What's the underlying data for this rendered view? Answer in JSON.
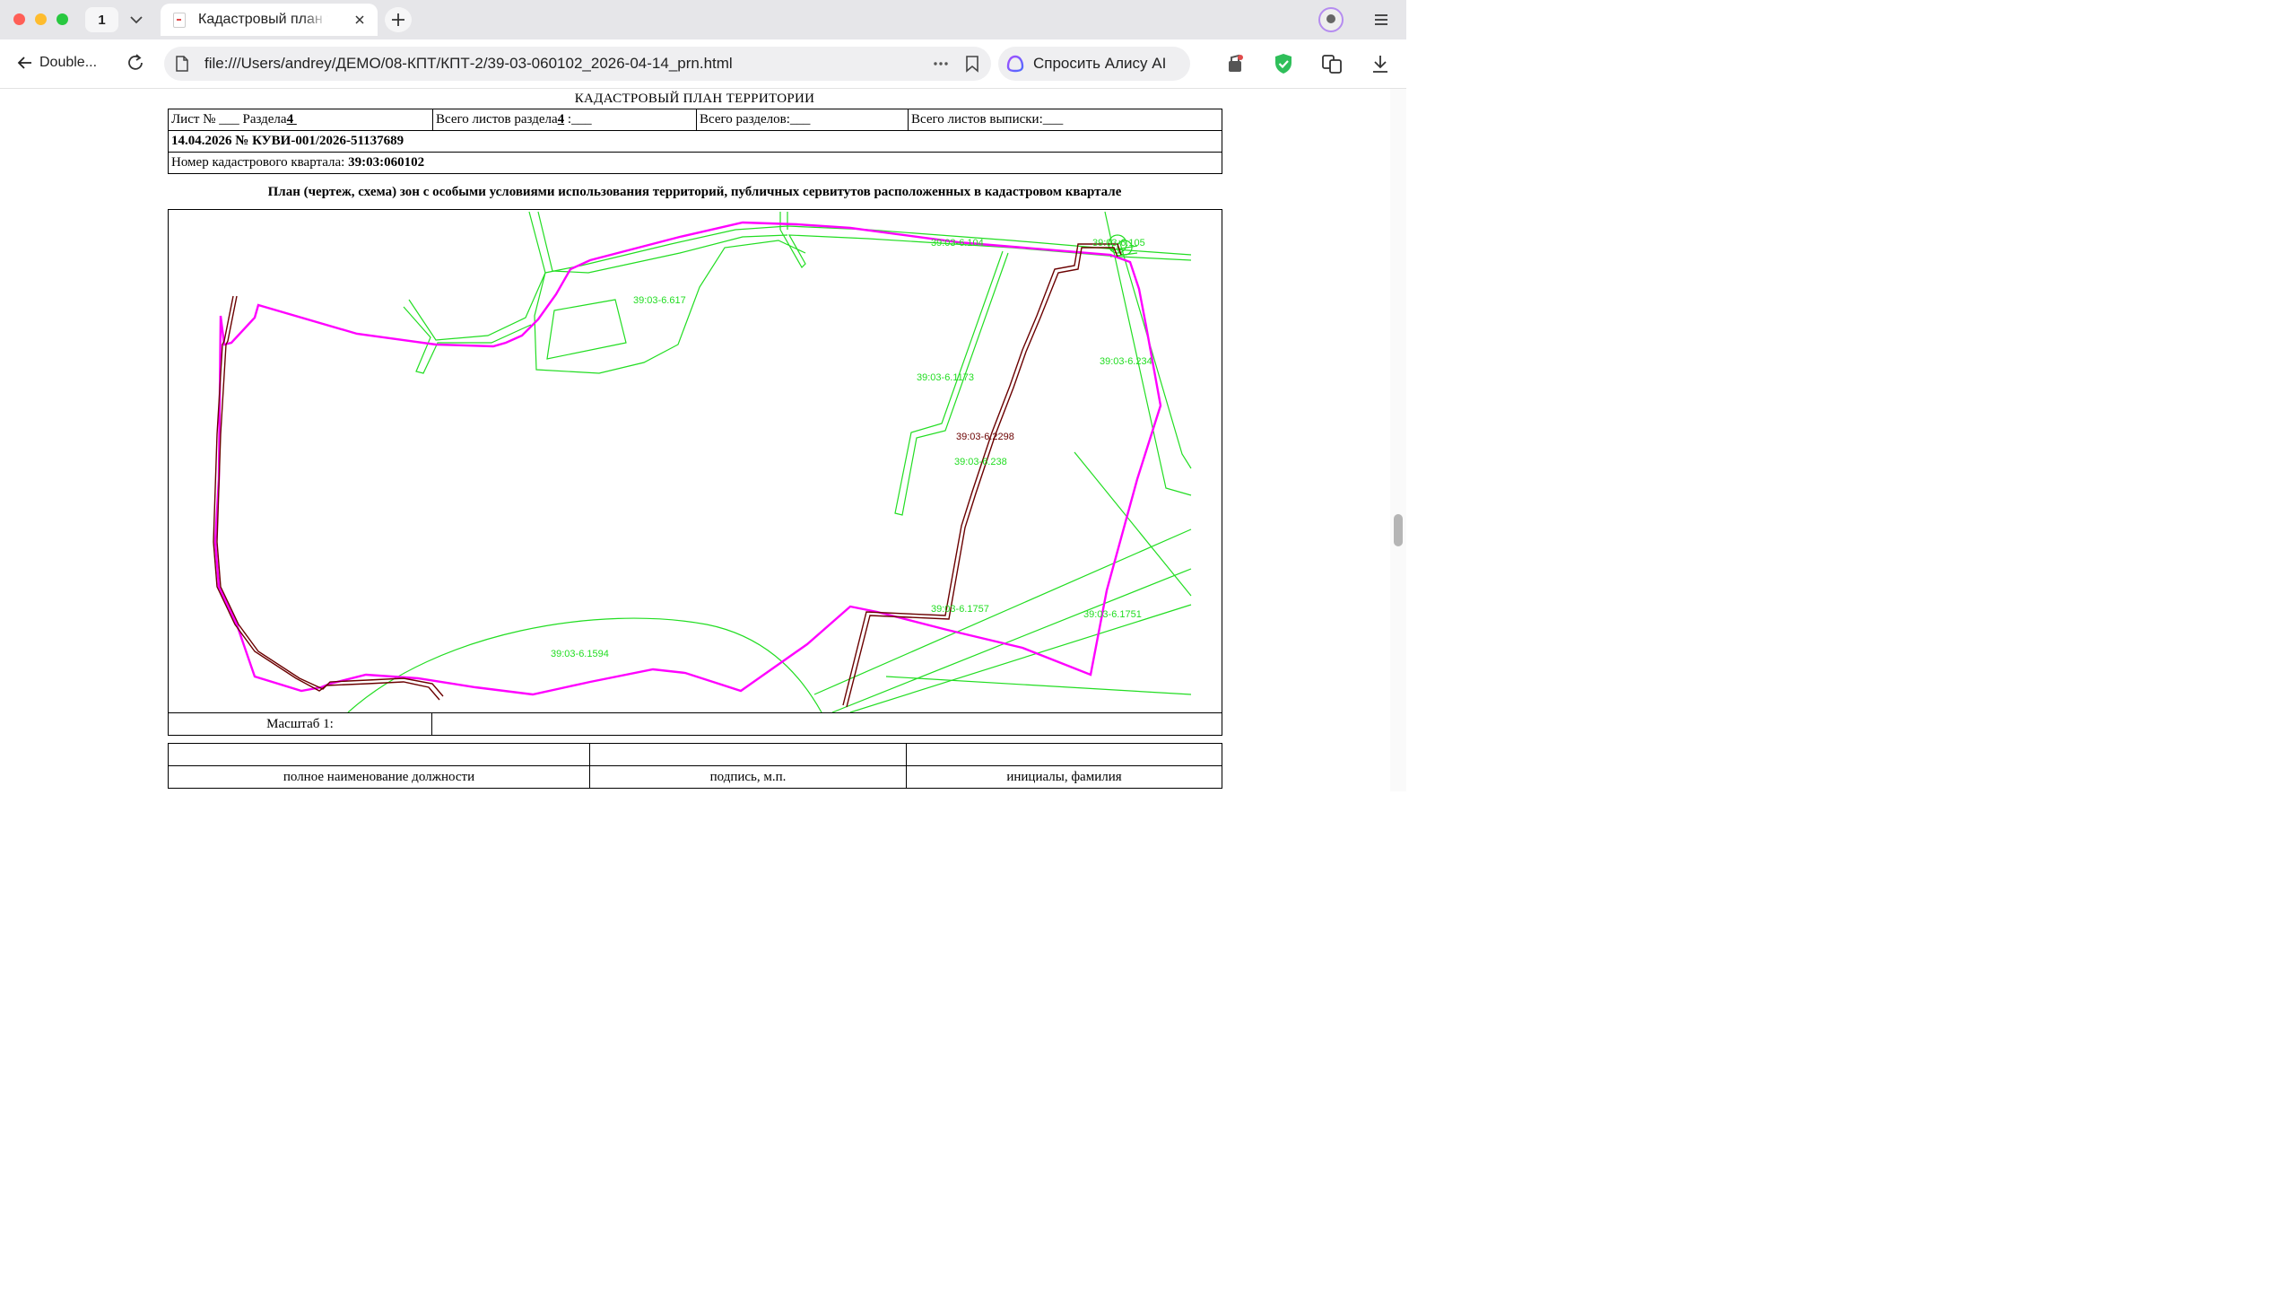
{
  "browser": {
    "tab_count": "1",
    "tab_title": "Кадастровый план территории",
    "back_label": "Double...",
    "url": "file:///Users/andrey/ДЕМО/08-КПТ/КПТ-2/39-03-060102_2026-04-14_prn.html",
    "alice_label": "Спросить Алису AI",
    "icons": [
      "chevron-down-icon",
      "close-icon",
      "plus-icon",
      "avatar",
      "menu-icon",
      "back-arrow-icon",
      "reload-icon",
      "file-icon",
      "more-icon",
      "bookmark-icon",
      "alice-icon",
      "extension-icon",
      "shield-icon",
      "translate-icon",
      "download-icon"
    ]
  },
  "document": {
    "title": "КАДАСТРОВЫЙ ПЛАН ТЕРРИТОРИИ",
    "sheet": {
      "prefix": "Лист № ",
      "blank": "___",
      "section_label": " Раздела",
      "section_value": "4"
    },
    "total_sheets_section": {
      "label": "Всего листов раздела",
      "value": "4",
      "sep": " :",
      "blank": "___"
    },
    "total_sections": {
      "label": "Всего разделов:",
      "blank": "___"
    },
    "total_sheets_extract": {
      "label": "Всего листов выписки:",
      "blank": "___"
    },
    "date_number": "14.04.2026 № КУВИ-001/2026-51137689",
    "quarter": {
      "label": "Номер кадастрового квартала: ",
      "value": "39:03:060102"
    },
    "plan_heading": "План (чертеж, схема) зон с особыми условиями использования территорий, публичных сервитутов расположенных в кадастровом квартале",
    "scale_label": "Масштаб 1:",
    "signature": {
      "position": "полное наименование должности",
      "sign": "подпись, м.п.",
      "name": "инициалы, фамилия"
    }
  },
  "map": {
    "colors": {
      "quarter_boundary": "#ff00ff",
      "zones": "#22dd22",
      "servitude": "#6b0000"
    },
    "labels": [
      {
        "text": "39:03-6.617",
        "kind": "zone"
      },
      {
        "text": "39:03-6.104",
        "kind": "zone"
      },
      {
        "text": "39:03-6.105",
        "kind": "zone"
      },
      {
        "text": "39:03-6.234",
        "kind": "zone"
      },
      {
        "text": "39:03-6.1173",
        "kind": "zone"
      },
      {
        "text": "39:03-6.2298",
        "kind": "servitude"
      },
      {
        "text": "39:03-6.238",
        "kind": "zone"
      },
      {
        "text": "39:03-6.1757",
        "kind": "zone"
      },
      {
        "text": "39:03-6.1751",
        "kind": "zone"
      },
      {
        "text": "39:03-6.1594",
        "kind": "zone"
      }
    ]
  }
}
